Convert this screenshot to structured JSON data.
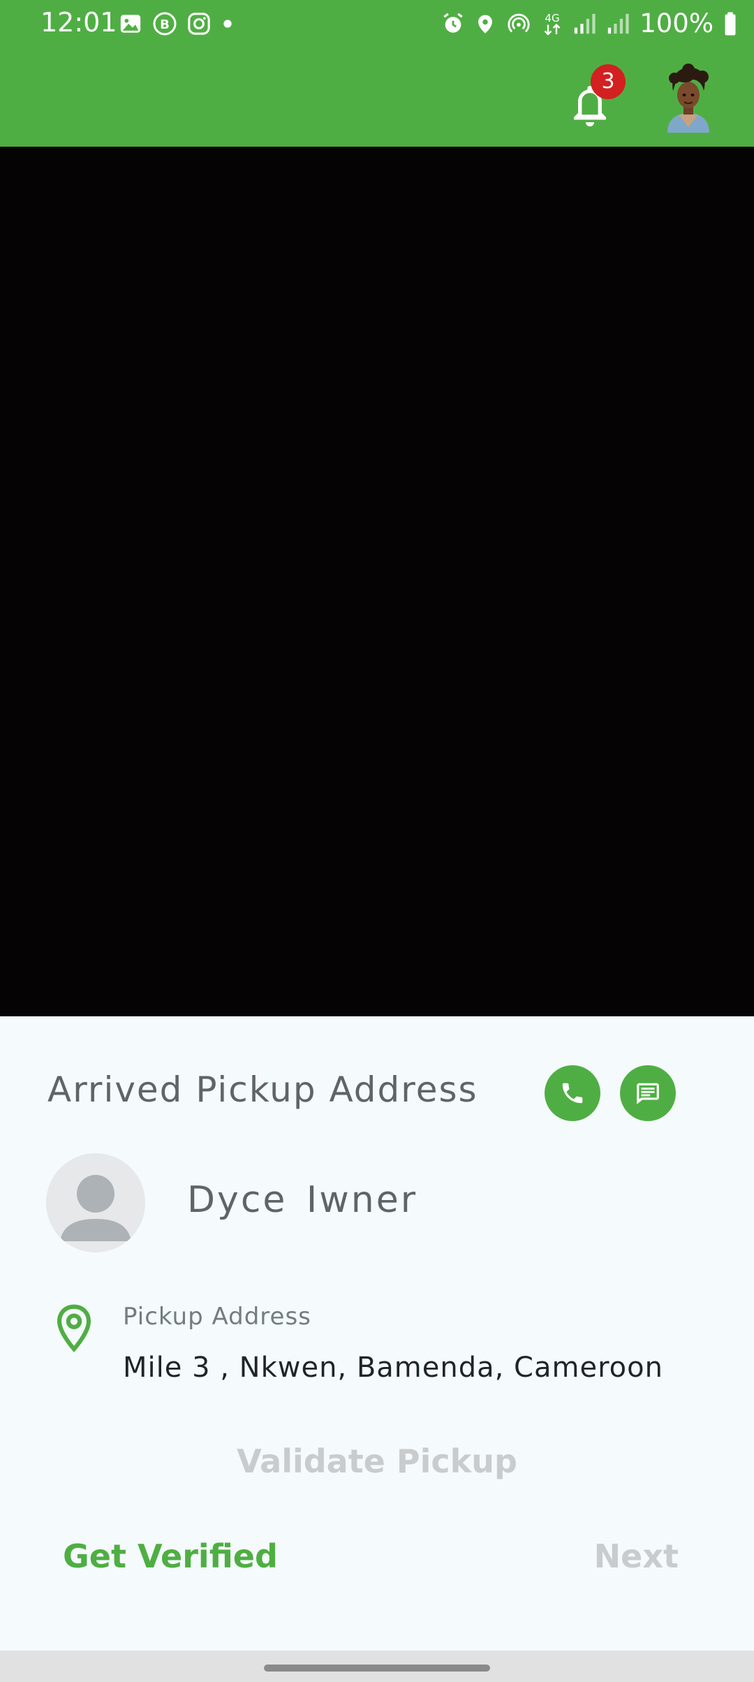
{
  "status_bar": {
    "time": "12:01",
    "battery": "100%",
    "left_icons": [
      "gallery-icon",
      "business-chat-icon",
      "instagram-icon",
      "dot-icon"
    ],
    "right_icons": [
      "alarm-icon",
      "location-icon",
      "hotspot-icon",
      "4g-icon",
      "signal-icon",
      "signal-icon-2",
      "battery-icon"
    ]
  },
  "app_bar": {
    "notification_count": "3",
    "accent_color": "#4fae43"
  },
  "pickup": {
    "title": "Arrived Pickup Address",
    "customer_name": "Dyce  Iwner",
    "address_label": "Pickup Address",
    "address_value": "Mile 3 , Nkwen, Bamenda, Cameroon",
    "validate_label": "Validate Pickup",
    "get_verified_label": "Get Verified",
    "next_label": "Next"
  }
}
